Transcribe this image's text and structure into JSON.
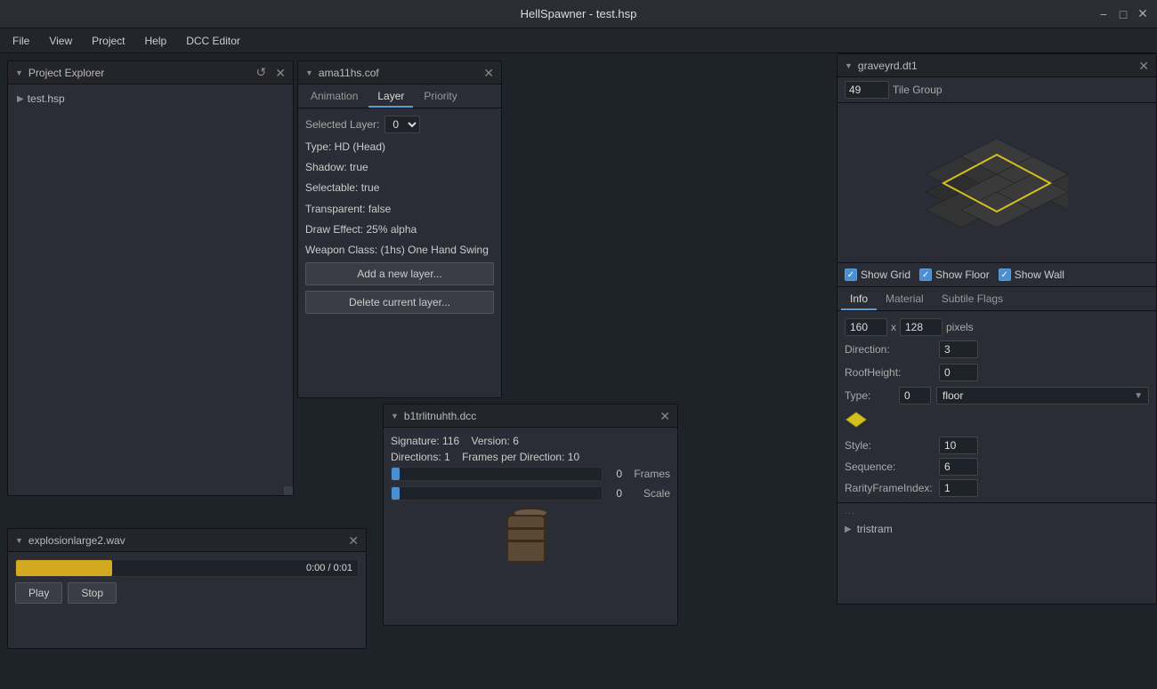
{
  "app": {
    "title": "HellSpawner - test.hsp",
    "window_controls": [
      "minimize",
      "maximize",
      "close"
    ]
  },
  "menu": {
    "items": [
      "File",
      "View",
      "Project",
      "Help",
      "DCC Editor"
    ]
  },
  "project_explorer": {
    "title": "Project Explorer",
    "refresh_label": "↺",
    "tree": [
      {
        "label": "test.hsp",
        "arrow": "▶"
      }
    ]
  },
  "cof_panel": {
    "title": "ama11hs.cof",
    "tabs": [
      "Animation",
      "Layer",
      "Priority"
    ],
    "active_tab": "Layer",
    "selected_layer_label": "Selected Layer:",
    "selected_layer_value": "0",
    "properties": [
      "Type: HD (Head)",
      "Shadow: true",
      "Selectable: true",
      "Transparent: false",
      "Draw Effect: 25% alpha",
      "Weapon Class: (1hs) One Hand Swing"
    ],
    "add_layer_btn": "Add a new layer...",
    "delete_layer_btn": "Delete current layer..."
  },
  "dcc_panel": {
    "title": "b1trlitnuhth.dcc",
    "signature_label": "Signature:",
    "signature_value": "116",
    "version_label": "Version:",
    "version_value": "6",
    "directions_label": "Directions:",
    "directions_value": "1",
    "frames_per_dir_label": "Frames per Direction:",
    "frames_per_dir_value": "10",
    "frames_bar_value": "0",
    "frames_bar_label": "Frames",
    "scale_bar_value": "0",
    "scale_bar_label": "Scale"
  },
  "audio_panel": {
    "title": "explosionlarge2.wav",
    "progress_fill_pct": 28,
    "time_current": "0:00",
    "time_total": "0:01",
    "play_label": "Play",
    "stop_label": "Stop"
  },
  "tileset_panel": {
    "title": "graveyrd.dt1",
    "tile_group_value": "49",
    "tile_group_label": "Tile Group",
    "checkboxes": [
      {
        "label": "Show Grid",
        "checked": true
      },
      {
        "label": "Show Floor",
        "checked": true
      },
      {
        "label": "Show Wall",
        "checked": true
      }
    ],
    "info_tabs": [
      "Info",
      "Material",
      "Subtile Flags"
    ],
    "active_info_tab": "Info",
    "size": {
      "width": "160",
      "x_label": "x",
      "height": "128",
      "unit": "pixels"
    },
    "direction_label": "Direction:",
    "direction_value": "3",
    "roof_height_label": "RoofHeight:",
    "roof_height_value": "0",
    "type_label": "Type:",
    "type_value": "0",
    "type_floor": "floor",
    "style_label": "Style:",
    "style_value": "10",
    "sequence_label": "Sequence:",
    "sequence_value": "6",
    "rarity_label": "RarityFrameIndex:",
    "rarity_value": "1",
    "bottom_list": [
      {
        "label": "tristram"
      }
    ]
  }
}
